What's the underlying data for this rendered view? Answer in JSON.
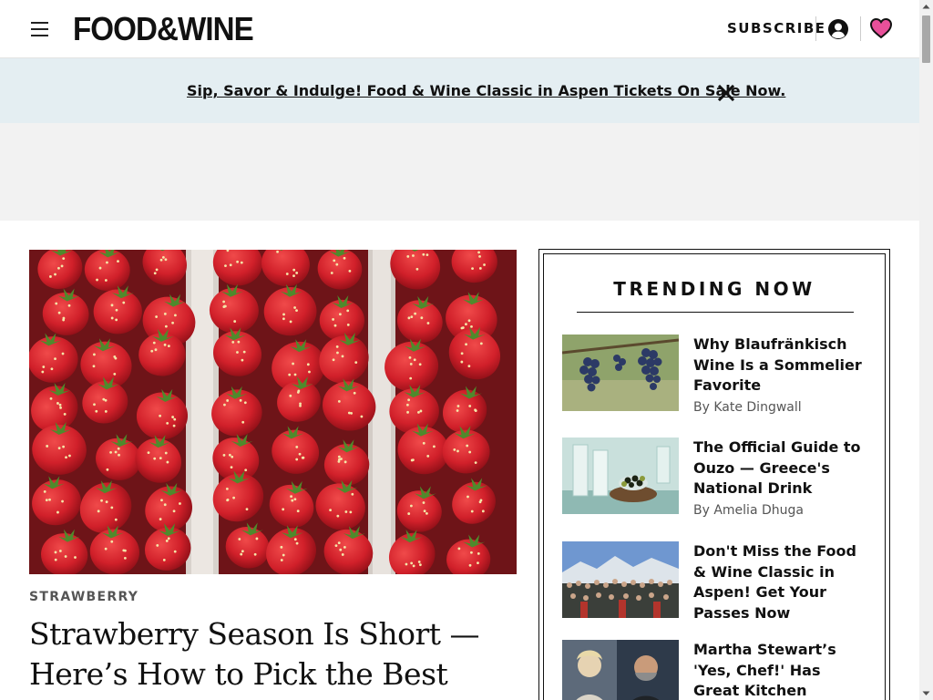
{
  "header": {
    "logo_text": "FOOD&WINE",
    "subscribe_label": "SUBSCRIBE"
  },
  "banner": {
    "text": "Sip, Savor & Indulge! Food & Wine Classic in Aspen Tickets On Sale Now."
  },
  "hero": {
    "eyebrow": "STRAWBERRY",
    "title": "Strawberry Season Is Short — Here’s How to Pick the Best"
  },
  "trending": {
    "title": "TRENDING NOW",
    "items": [
      {
        "headline": "Why Blaufränkisch Wine Is a Sommelier Favorite",
        "byline": "By Kate Dingwall"
      },
      {
        "headline": "The Official Guide to Ouzo — Greece's National Drink",
        "byline": "By Amelia Dhuga"
      },
      {
        "headline": "Don't Miss the Food & Wine Classic in Aspen! Get Your Passes Now",
        "byline": ""
      },
      {
        "headline": "Martha Stewart’s 'Yes, Chef!' Has Great Kitchen Essentials",
        "byline": ""
      }
    ]
  },
  "colors": {
    "banner_bg": "#e4eef2",
    "heart": "#e8509a",
    "strawberry": "#d1202a"
  }
}
